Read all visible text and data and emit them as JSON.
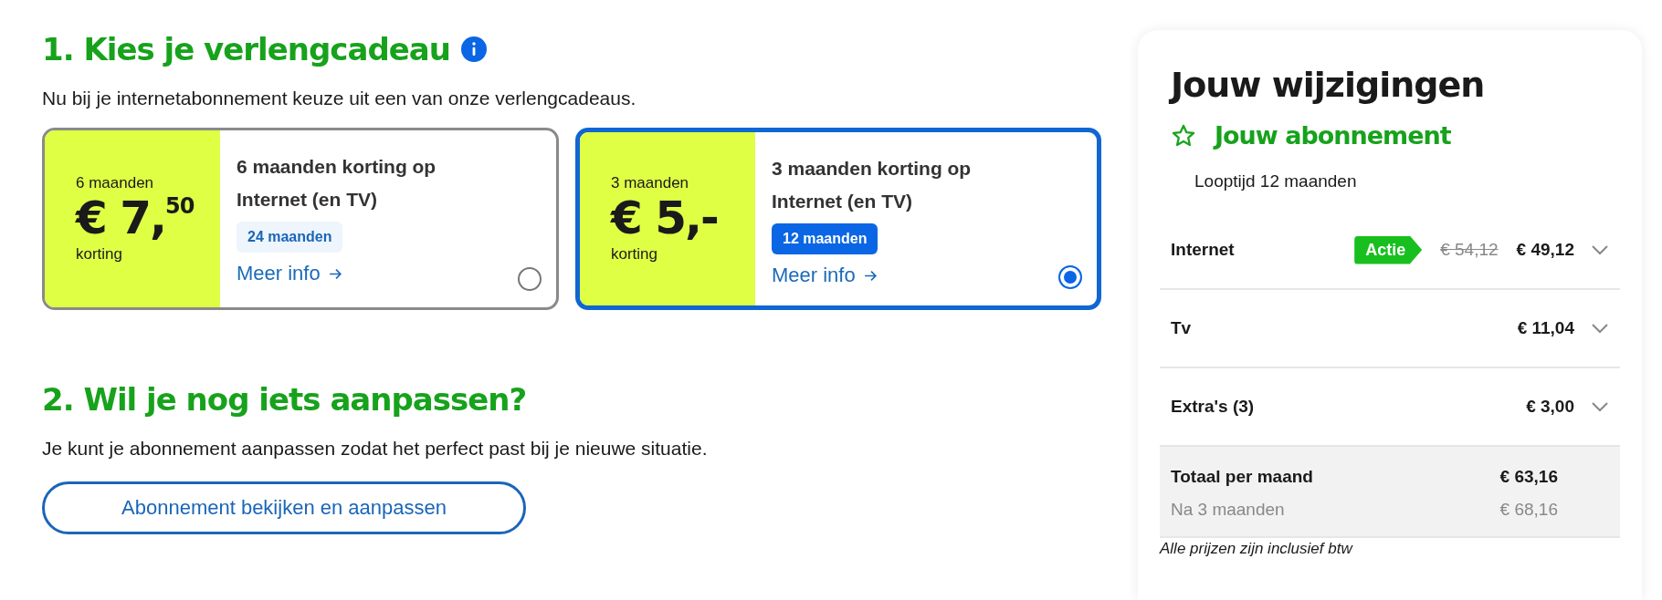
{
  "gift_section": {
    "heading": "1. Kies je verlengcadeau",
    "intro": "Nu bij je internetabonnement keuze uit een van onze verlengcadeaus.",
    "options": [
      {
        "duration": "6 maanden",
        "price": "€ 7,$^{50}$",
        "price_note": "korting",
        "title": "6 maanden korting op Internet (en TV)",
        "term_badge": "24 maanden",
        "link": "Meer info",
        "selected": false
      },
      {
        "duration": "3 maanden",
        "price": "€ 5,-",
        "price_note": "korting",
        "title": "3 maanden korting op Internet (en TV)",
        "term_badge": "12 maanden",
        "link": "Meer info",
        "selected": true
      }
    ]
  },
  "adjust_section": {
    "heading": "2. Wil je nog iets aanpassen?",
    "text": "Je kunt je abonnement aanpassen zodat het perfect past bij je nieuwe situatie.",
    "button": "Abonnement bekijken en aanpassen"
  },
  "summary": {
    "title": "Jouw wijzigingen",
    "subtitle": "Jouw abonnement",
    "term": "Looptijd 12 maanden",
    "rows": [
      {
        "label": "Internet",
        "badge": "Actie",
        "old_price": "€ 54,12",
        "price": "€ 49,12",
        "expanded": false
      },
      {
        "label": "Tv",
        "price": "€ 11,04",
        "expanded": false
      },
      {
        "label": "Extra's (3)",
        "price": "€ 3,00",
        "expanded": false
      }
    ],
    "total": {
      "label": "Totaal per maand",
      "price": "€ 63,16",
      "later_label": "Na 3 maanden",
      "later_price": "€ 68,16"
    },
    "footnote": "Alle prijzen zijn inclusief btw"
  }
}
